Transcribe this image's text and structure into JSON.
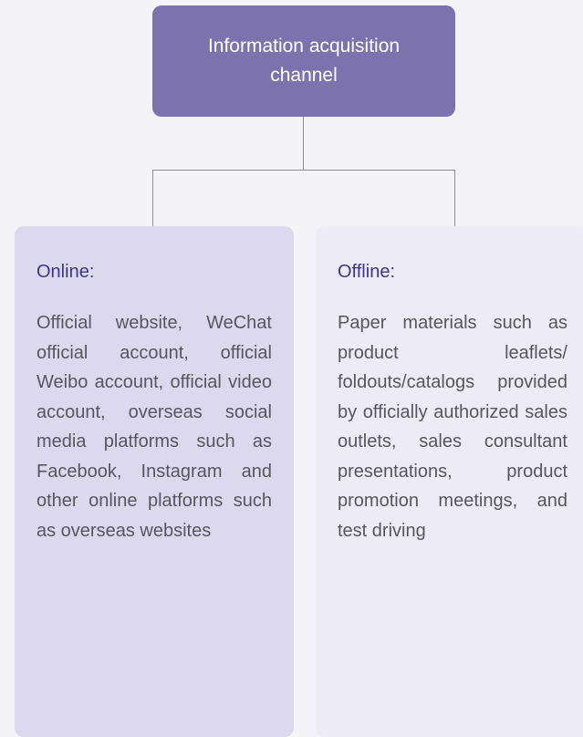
{
  "root": {
    "title": "Information acquisition channel"
  },
  "branches": [
    {
      "title": "Online:",
      "body": "Official website, WeChat official account, official Weibo account, official video account, overseas social media platforms such as Facebook, Instagram and other online platforms such as overseas websites"
    },
    {
      "title": "Offline:",
      "body": "Paper materials such as product leaflets/ foldouts/catalogs provided by officially authorized sales outlets, sales consultant presentations, product promotion meetings, and test driving"
    }
  ],
  "colors": {
    "root_fill": "#7c73ae",
    "online_fill": "#dcd9ee",
    "offline_fill": "#ecebf6",
    "heading_text": "#3f3684",
    "body_text": "#57565e",
    "connector": "#8d8d92"
  }
}
